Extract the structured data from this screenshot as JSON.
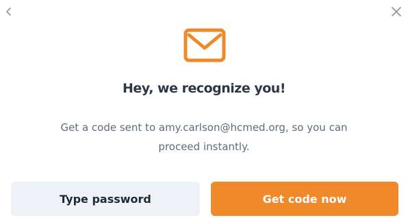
{
  "nav": {
    "back_icon": "chevron-left-icon",
    "close_icon": "close-icon"
  },
  "hero": {
    "icon": "envelope-icon",
    "icon_color": "#f0892a"
  },
  "content": {
    "title": "Hey, we recognize you!",
    "message_line1": "Get a code sent to amy.carlson@hcmed.org, so you can",
    "message_line2": "proceed instantly."
  },
  "actions": {
    "secondary_label": "Type password",
    "primary_label": "Get code now",
    "primary_color": "#f0892a",
    "secondary_color": "#eef1f5"
  }
}
